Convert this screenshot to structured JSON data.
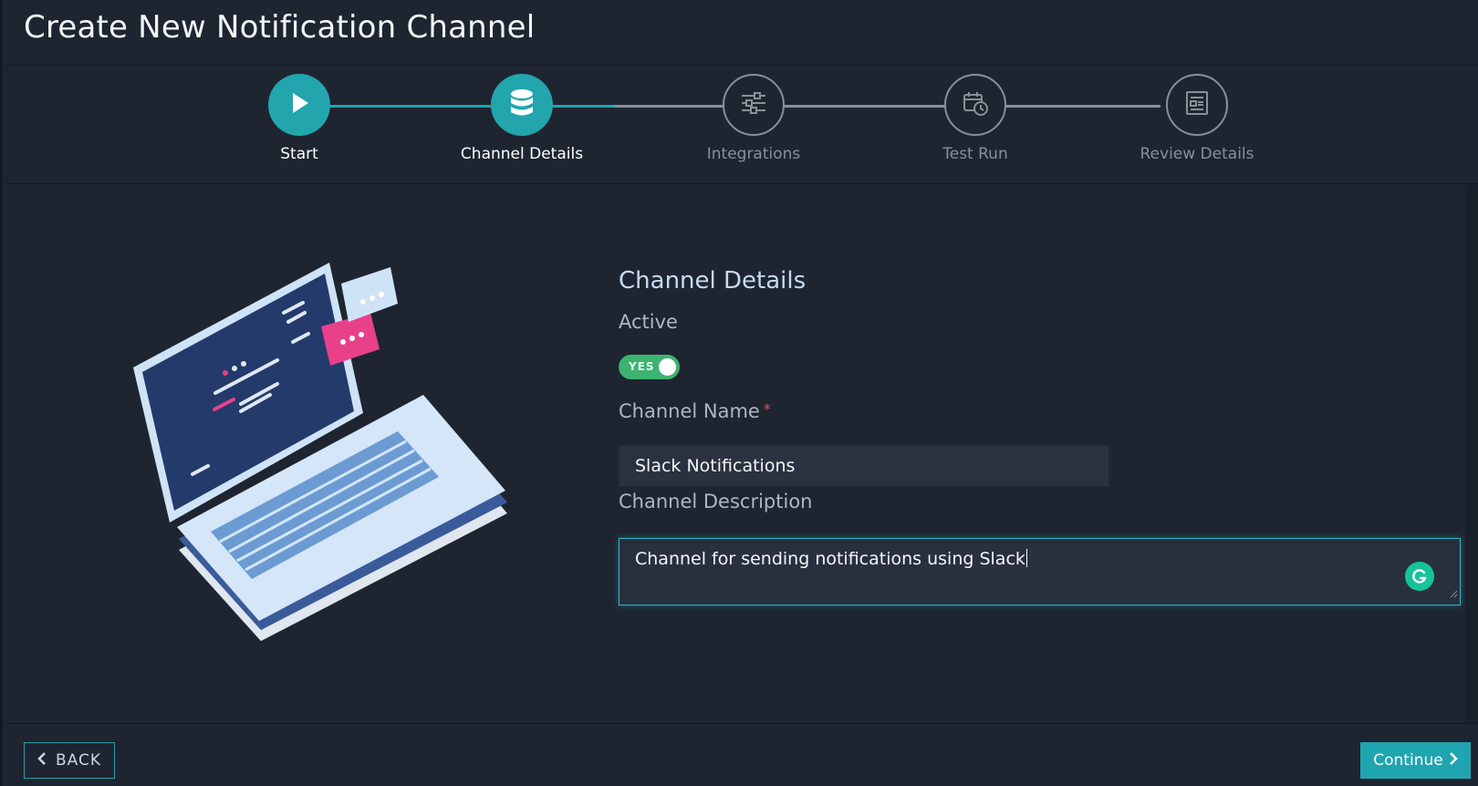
{
  "header": {
    "title": "Create New Notification Channel"
  },
  "stepper": {
    "steps": [
      {
        "label": "Start",
        "state": "done",
        "icon": "play-icon"
      },
      {
        "label": "Channel Details",
        "state": "current",
        "icon": "database-icon"
      },
      {
        "label": "Integrations",
        "state": "todo",
        "icon": "sliders-icon"
      },
      {
        "label": "Test Run",
        "state": "todo",
        "icon": "calendar-clock-icon"
      },
      {
        "label": "Review Details",
        "state": "todo",
        "icon": "document-list-icon"
      }
    ]
  },
  "form": {
    "section_title": "Channel Details",
    "active_label": "Active",
    "active_toggle_text": "YES",
    "active_value": true,
    "name_label": "Channel Name",
    "name_required_mark": "*",
    "name_value": "Slack Notifications",
    "description_label": "Channel Description",
    "description_value": "Channel for sending notifications using Slack"
  },
  "footer": {
    "back_label": "BACK",
    "continue_label": "Continue"
  },
  "colors": {
    "background": "#1e2531",
    "accent": "#22a5ad",
    "toggle_on": "#3cb371",
    "inactive_step": "#8a8f98",
    "pink": "#e8418a"
  }
}
